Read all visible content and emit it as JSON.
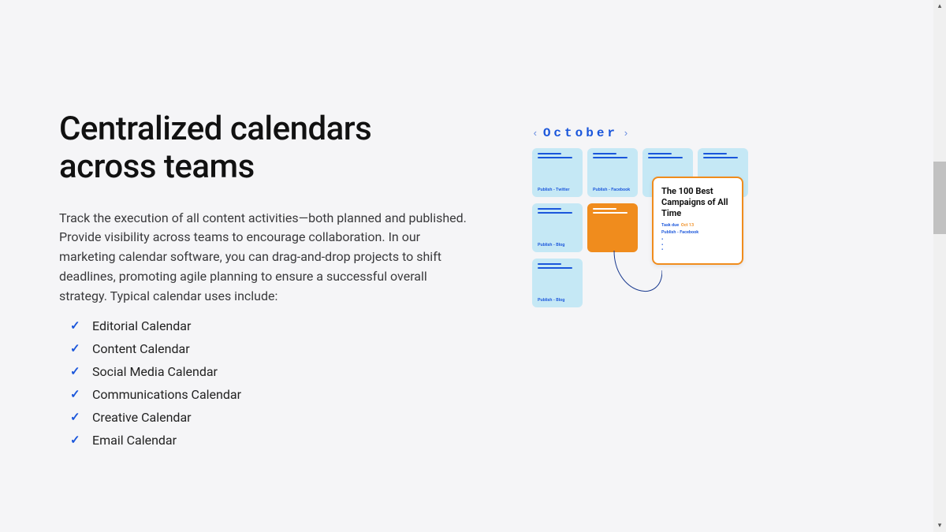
{
  "heading": "Centralized calendars across teams",
  "description": "Track the execution of all content activities—both planned and published. Provide visibility across teams to encourage collaboration. In our marketing calendar software, you can drag-and-drop projects to shift deadlines, promoting agile planning to ensure a successful overall strategy. Typical calendar uses include:",
  "checklist": {
    "item0": "Editorial Calendar",
    "item1": "Content Calendar",
    "item2": "Social Media Calendar",
    "item3": "Communications Calendar",
    "item4": "Creative Calendar",
    "item5": "Email Calendar"
  },
  "calendar": {
    "month": "October",
    "cards": {
      "c0": "Publish - Twitter",
      "c1": "Publish - Facebook",
      "c2": "Publish - Blog",
      "c3": "Publish - Blog"
    },
    "detail": {
      "title": "The 100 Best Campaigns of All Time",
      "task_label": "Task due",
      "task_date": "Oct 13",
      "publish": "Publish - Facebook"
    }
  }
}
